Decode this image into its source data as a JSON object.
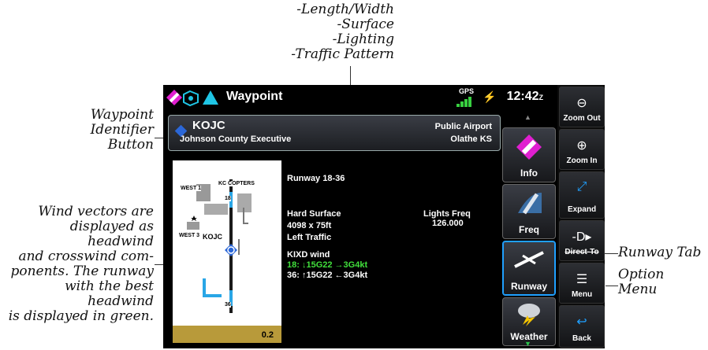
{
  "callouts": {
    "runway_info": [
      "-Length/Width",
      "-Surface",
      "-Lighting",
      "-Traffic Pattern"
    ],
    "waypoint_id": [
      "Waypoint",
      "Identifier",
      "Button"
    ],
    "wind": [
      "Wind vectors are",
      "displayed as headwind",
      "and crosswind com-",
      "ponents.  The runway",
      "with the best headwind",
      "is displayed in green."
    ],
    "runway_tab": "Runway Tab",
    "option_menu": [
      "Option",
      "Menu"
    ]
  },
  "topbar": {
    "title": "Waypoint",
    "gps": "GPS",
    "time": "12:42",
    "time_suffix": "Z"
  },
  "waypoint": {
    "id": "KOJC",
    "name": "Johnson County Executive",
    "type": "Public Airport",
    "city": "Olathe KS"
  },
  "map": {
    "labels": [
      "WEST 1",
      "KC COPTERS",
      "WEST 3",
      "KOJC",
      "18",
      "36"
    ],
    "scale": "0.2"
  },
  "runway": {
    "name": "Runway 18-36",
    "surface": "Hard Surface",
    "dims": "4098 x 75ft",
    "traffic": "Left Traffic",
    "lights_label": "Lights Freq",
    "lights_freq": "126.000",
    "wind_title": "KIXD wind",
    "wind_18": "18: ↓15G22 →3G4kt",
    "wind_36": "36: ↑15G22 ←3G4kt"
  },
  "tabs": [
    {
      "label": "Info"
    },
    {
      "label": "Freq"
    },
    {
      "label": "Runway"
    },
    {
      "label": "Weather"
    }
  ],
  "side": [
    {
      "label": "Zoom Out"
    },
    {
      "label": "Zoom In"
    },
    {
      "label": "Expand"
    },
    {
      "label": "Direct-To"
    },
    {
      "label": "Menu"
    },
    {
      "label": "Back"
    }
  ],
  "colors": {
    "accent_blue": "#1fa0ff",
    "wind_green": "#41e03c",
    "info_magenta": "#e01fd0",
    "screen_bg": "#000000"
  }
}
